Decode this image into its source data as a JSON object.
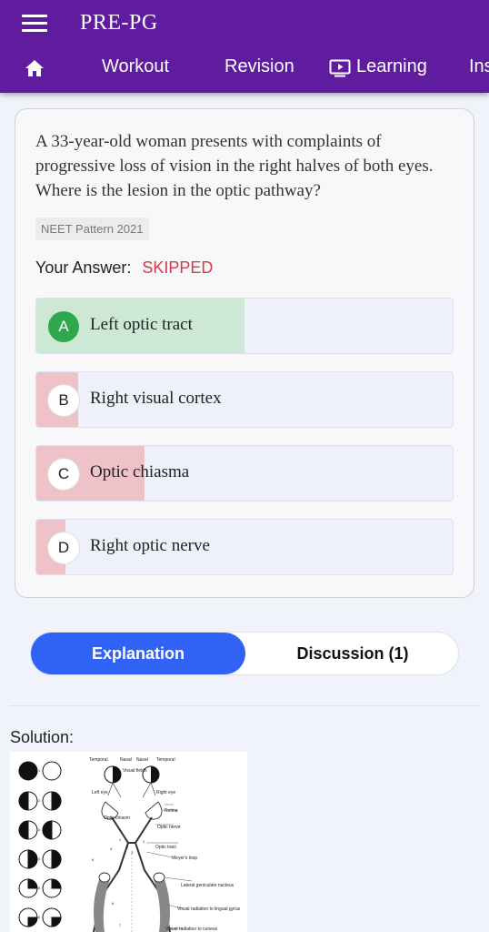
{
  "app": {
    "title": "PRE-PG"
  },
  "nav": {
    "home_icon": "home-icon",
    "items": [
      {
        "label": "Workout"
      },
      {
        "label": "Revision"
      },
      {
        "label": "Learning",
        "icon": "play-screen-icon"
      },
      {
        "label": "Ins"
      }
    ]
  },
  "question": {
    "text": "A 33-year-old woman presents with complaints of progressive loss of vision in the right halves of both eyes. Where is the lesion in the optic pathway?",
    "tag": "NEET Pattern 2021",
    "answer_label": "Your Answer:",
    "answer_value": "SKIPPED",
    "options": [
      {
        "letter": "A",
        "text": "Left optic tract",
        "percent": 50,
        "correct": true
      },
      {
        "letter": "B",
        "text": "Right visual cortex",
        "percent": 10,
        "correct": false
      },
      {
        "letter": "C",
        "text": "Optic chiasma",
        "percent": 26,
        "correct": false
      },
      {
        "letter": "D",
        "text": "Right optic nerve",
        "percent": 7,
        "correct": false
      }
    ]
  },
  "colors": {
    "primary": "#5f1c9f",
    "correct_fill": "#cde8d5",
    "wrong_fill": "#efc1c8",
    "active_tab": "#2f62f5",
    "skipped": "#d43a4a"
  },
  "tabs": {
    "explanation": "Explanation",
    "discussion": "Discussion (1)"
  },
  "solution": {
    "label": "Solution:",
    "figure_labels": {
      "temporal_left": "Temporal",
      "nasal_left": "Nasal",
      "nasal_right": "Nasal",
      "temporal_right": "Temporal",
      "visual_fields": "Visual fields",
      "left_eye": "Left eye",
      "right_eye": "Right eye",
      "retina": "Retina",
      "optic_chiasm": "Optic chiasm",
      "optic_nerve": "Optic nerve",
      "optic_tract": "Optic tract",
      "meyers_loop": "Meyer's loop",
      "lgn": "Lateral geniculate nucleus",
      "radiation_lingual": "Visual radiation to lingual gyrus",
      "radiation_cuneus": "Visual radiation to cuneus"
    }
  }
}
